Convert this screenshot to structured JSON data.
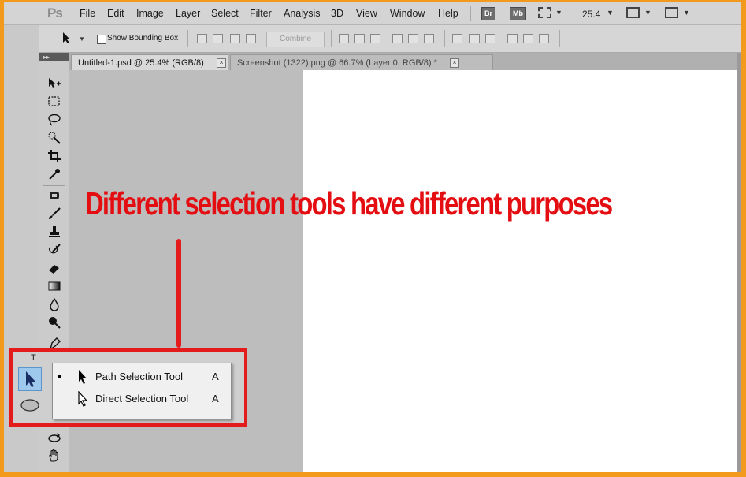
{
  "app": {
    "logo": "Ps"
  },
  "menu": [
    "File",
    "Edit",
    "Image",
    "Layer",
    "Select",
    "Filter",
    "Analysis",
    "3D",
    "View",
    "Window",
    "Help"
  ],
  "menubar_right": {
    "bridge_label": "Br",
    "minibridge_label": "Mb",
    "zoom": "25.4"
  },
  "options": {
    "show_bounding_box_label": "Show Bounding Box",
    "combine_label": "Combine"
  },
  "tabs": [
    {
      "label": "Untitled-1.psd @ 25.4% (RGB/8)",
      "close": "×"
    },
    {
      "label": "Screenshot (1322).png @ 66.7% (Layer 0, RGB/8) *",
      "close": "×"
    }
  ],
  "toolbox": {
    "collapse_glyph": "▸▸"
  },
  "annotation": {
    "text": "Different selection tools have different purposes"
  },
  "flyout": {
    "items": [
      {
        "label": "Path Selection Tool",
        "shortcut": "A",
        "selected": true
      },
      {
        "label": "Direct Selection Tool",
        "shortcut": "A",
        "selected": false
      }
    ]
  },
  "colors": {
    "annotation_red": "#e40e12",
    "border_orange": "#f39a1c",
    "canvas": "#ffffff"
  }
}
